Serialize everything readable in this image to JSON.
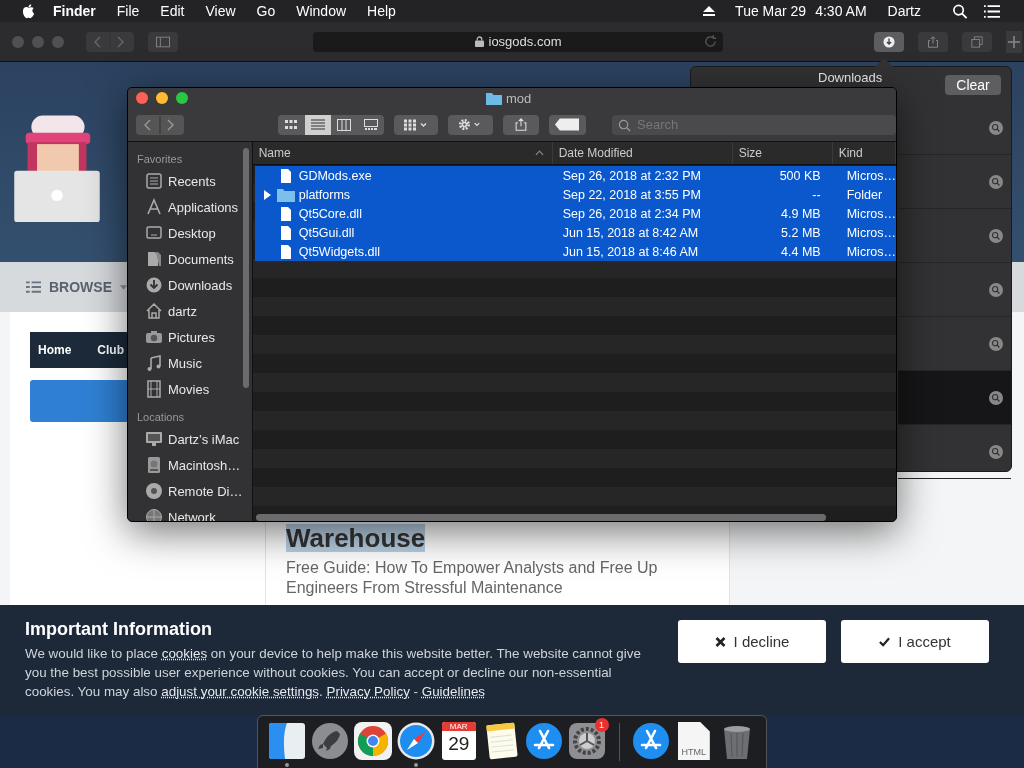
{
  "menu_bar": {
    "app": "Finder",
    "menus": [
      "File",
      "Edit",
      "View",
      "Go",
      "Window",
      "Help"
    ],
    "date": "Tue Mar 29",
    "time": "4:30 AM",
    "user": "Dartz"
  },
  "browser": {
    "url": "iosgods.com",
    "toolbar_buttons": [
      {
        "kind": "downloads",
        "selected": true
      },
      {
        "kind": "share",
        "selected": false
      },
      {
        "kind": "tabs",
        "selected": false
      }
    ]
  },
  "web_page": {
    "nav_label": "BROWSE",
    "breadcrumb": [
      "Home",
      "Club"
    ],
    "article_title": "Warehouse",
    "article_summary": "Free Guide: How To Empower Analysts and Free Up Engineers From Stressful Maintenance"
  },
  "downloads": {
    "title": "Downloads",
    "clear_button": "Clear",
    "rows": [
      {
        "selected": false
      },
      {
        "selected": false
      },
      {
        "selected": false
      },
      {
        "selected": false
      },
      {
        "selected": false
      },
      {
        "selected": true
      },
      {
        "selected": false
      }
    ]
  },
  "finder": {
    "title": "mod",
    "view_modes": [
      {
        "kind": "icons",
        "selected": false
      },
      {
        "kind": "list",
        "selected": true
      },
      {
        "kind": "columns",
        "selected": false
      },
      {
        "kind": "gallery",
        "selected": false
      }
    ],
    "search": {
      "placeholder": "Search"
    },
    "sidebar": [
      {
        "heading": "Favorites",
        "items": [
          {
            "label": "Recents",
            "kind": "recents"
          },
          {
            "label": "Applications",
            "kind": "applications"
          },
          {
            "label": "Desktop",
            "kind": "desktop"
          },
          {
            "label": "Documents",
            "kind": "documents"
          },
          {
            "label": "Downloads",
            "kind": "downloads"
          },
          {
            "label": "dartz",
            "kind": "home"
          },
          {
            "label": "Pictures",
            "kind": "pictures"
          },
          {
            "label": "Music",
            "kind": "music"
          },
          {
            "label": "Movies",
            "kind": "movies"
          }
        ]
      },
      {
        "heading": "Locations",
        "items": [
          {
            "label": "Dartz’s iMac",
            "kind": "computer"
          },
          {
            "label": "Macintosh…",
            "kind": "disk"
          },
          {
            "label": "Remote Di…",
            "kind": "disc"
          },
          {
            "label": "Network",
            "kind": "network"
          }
        ]
      }
    ],
    "columns": [
      "Name",
      "Date Modified",
      "Size",
      "Kind"
    ],
    "files": [
      {
        "name": "GDMods.exe",
        "kind": "file",
        "date": "Sep 26, 2018 at 2:32 PM",
        "size": "500 KB",
        "kind_label": "Micros…",
        "selected": true
      },
      {
        "name": "platforms",
        "kind": "folder",
        "expanded": false,
        "date": "Sep 22, 2018 at 3:55 PM",
        "size": "--",
        "kind_label": "Folder",
        "selected": true
      },
      {
        "name": "Qt5Core.dll",
        "kind": "file",
        "date": "Sep 26, 2018 at 2:34 PM",
        "size": "4.9 MB",
        "kind_label": "Micros…",
        "selected": true
      },
      {
        "name": "Qt5Gui.dll",
        "kind": "file",
        "date": "Jun 15, 2018 at 8:42 AM",
        "size": "5.2 MB",
        "kind_label": "Micros…",
        "selected": true
      },
      {
        "name": "Qt5Widgets.dll",
        "kind": "file",
        "date": "Jun 15, 2018 at 8:46 AM",
        "size": "4.4 MB",
        "kind_label": "Micros…",
        "selected": true
      }
    ]
  },
  "cookie_banner": {
    "title": "Important Information",
    "notice": [
      {
        "kind": "text",
        "text": "We would like to place "
      },
      {
        "kind": "link",
        "text": "cookies"
      },
      {
        "kind": "text",
        "text": " on your device to help make this website better. The website cannot give you the best possible user experience without cookies. You can accept or decline our non-essential cookies. You may also "
      },
      {
        "kind": "link",
        "text": "adjust your cookie settings"
      },
      {
        "kind": "text",
        "text": ". "
      },
      {
        "kind": "link",
        "text": "Privacy Policy"
      },
      {
        "kind": "text",
        "text": " - "
      },
      {
        "kind": "link",
        "text": "Guidelines"
      }
    ],
    "buttons": [
      {
        "kind": "decline",
        "label": "I decline"
      },
      {
        "kind": "accept",
        "label": "I accept"
      }
    ]
  },
  "dock": {
    "apps": [
      {
        "kind": "finder",
        "running": true
      },
      {
        "kind": "launchpad",
        "running": false
      },
      {
        "kind": "chrome",
        "running": false
      },
      {
        "kind": "safari",
        "running": true
      },
      {
        "kind": "calendar",
        "running": false,
        "month": "MAR",
        "day": "29"
      },
      {
        "kind": "notes",
        "running": false
      },
      {
        "kind": "app-store",
        "running": false
      },
      {
        "kind": "settings",
        "running": false,
        "badge": "1"
      }
    ],
    "others": [
      {
        "kind": "app-store"
      },
      {
        "kind": "document",
        "label": "HTML"
      },
      {
        "kind": "trash"
      }
    ]
  }
}
